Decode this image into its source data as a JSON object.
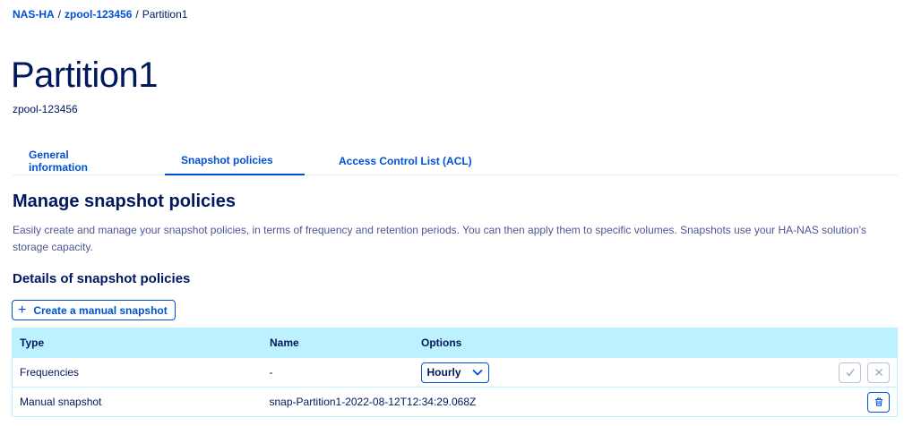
{
  "breadcrumb": {
    "items": [
      "NAS-HA",
      "zpool-123456"
    ],
    "separator": "/",
    "current": "Partition1"
  },
  "page": {
    "title": "Partition1",
    "subtitle": "zpool-123456"
  },
  "tabs": [
    {
      "label": "General information",
      "active": false
    },
    {
      "label": "Snapshot policies",
      "active": true
    },
    {
      "label": "Access Control List (ACL)",
      "active": false
    }
  ],
  "section": {
    "title": "Manage snapshot policies",
    "description": "Easily create and manage your snapshot policies, in terms of frequency and retention periods. You can then apply them to specific volumes. Snapshots use your HA-NAS solution’s storage capacity."
  },
  "details": {
    "title": "Details of snapshot policies",
    "create_button": "Create a manual snapshot"
  },
  "table": {
    "headers": [
      "Type",
      "Name",
      "Options"
    ],
    "rows": [
      {
        "type": "Frequencies",
        "name": "-",
        "option": "Hourly"
      },
      {
        "type": "Manual snapshot",
        "name": "snap-Partition1-2022-08-12T12:34:29.068Z"
      }
    ]
  },
  "icons": {
    "create": "plus-icon",
    "select": "chevron-down-icon",
    "confirm": "check-icon",
    "cancel": "close-icon",
    "delete": "trash-icon"
  },
  "colors": {
    "primary": "#0050d7",
    "text": "#00185e",
    "table_header": "#bef1ff"
  }
}
